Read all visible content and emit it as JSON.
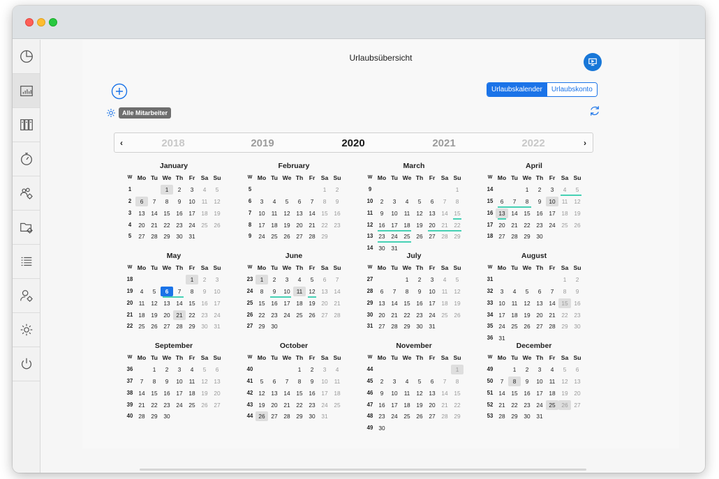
{
  "window": {
    "title": "Urlaubsübersicht"
  },
  "sidebar": {
    "items": [
      {
        "icon": "pie-chart-icon"
      },
      {
        "icon": "bar-chart-icon"
      },
      {
        "icon": "binders-icon"
      },
      {
        "icon": "stopwatch-icon"
      },
      {
        "icon": "team-settings-icon"
      },
      {
        "icon": "folder-settings-icon"
      },
      {
        "icon": "list-icon"
      },
      {
        "icon": "user-settings-icon"
      },
      {
        "icon": "gear-icon"
      },
      {
        "icon": "power-icon"
      }
    ],
    "active_index": 1
  },
  "toolbar": {
    "filter_label": "Alle Mitarbeiter",
    "tabs": [
      {
        "label": "Urlaubskalender",
        "selected": true
      },
      {
        "label": "Urlaubskonto",
        "selected": false
      }
    ]
  },
  "yearnav": {
    "prev": "‹",
    "next": "›",
    "years": [
      {
        "label": "2018",
        "level": "dim"
      },
      {
        "label": "2019",
        "level": "mid"
      },
      {
        "label": "2020",
        "level": "current"
      },
      {
        "label": "2021",
        "level": "mid"
      },
      {
        "label": "2022",
        "level": "dim"
      }
    ]
  },
  "calendar": {
    "year": 2020,
    "weekday_headers": [
      "W",
      "Mo",
      "Tu",
      "We",
      "Th",
      "Fr",
      "Sa",
      "Su"
    ],
    "month_names": [
      "January",
      "February",
      "March",
      "April",
      "May",
      "June",
      "July",
      "August",
      "September",
      "October",
      "November",
      "December"
    ],
    "today": [
      5,
      6
    ],
    "holidays": [
      [
        1,
        1
      ],
      [
        1,
        6
      ],
      [
        4,
        10
      ],
      [
        4,
        13
      ],
      [
        5,
        1
      ],
      [
        5,
        21
      ],
      [
        6,
        1
      ],
      [
        6,
        11
      ],
      [
        8,
        15
      ],
      [
        10,
        26
      ],
      [
        11,
        1
      ],
      [
        12,
        8
      ],
      [
        12,
        25
      ],
      [
        12,
        26
      ]
    ],
    "vacation_ranges": [
      [
        3,
        15,
        15
      ],
      [
        3,
        16,
        18
      ],
      [
        3,
        20,
        22
      ],
      [
        3,
        23,
        25
      ],
      [
        4,
        4,
        5
      ],
      [
        4,
        6,
        8
      ],
      [
        4,
        13,
        13
      ],
      [
        5,
        6,
        7
      ],
      [
        6,
        9,
        10
      ],
      [
        6,
        12,
        12
      ]
    ]
  },
  "colors": {
    "accent": "#1a73e8",
    "vacation_underline": "#46d1b4",
    "holiday_bg": "#dedede"
  }
}
